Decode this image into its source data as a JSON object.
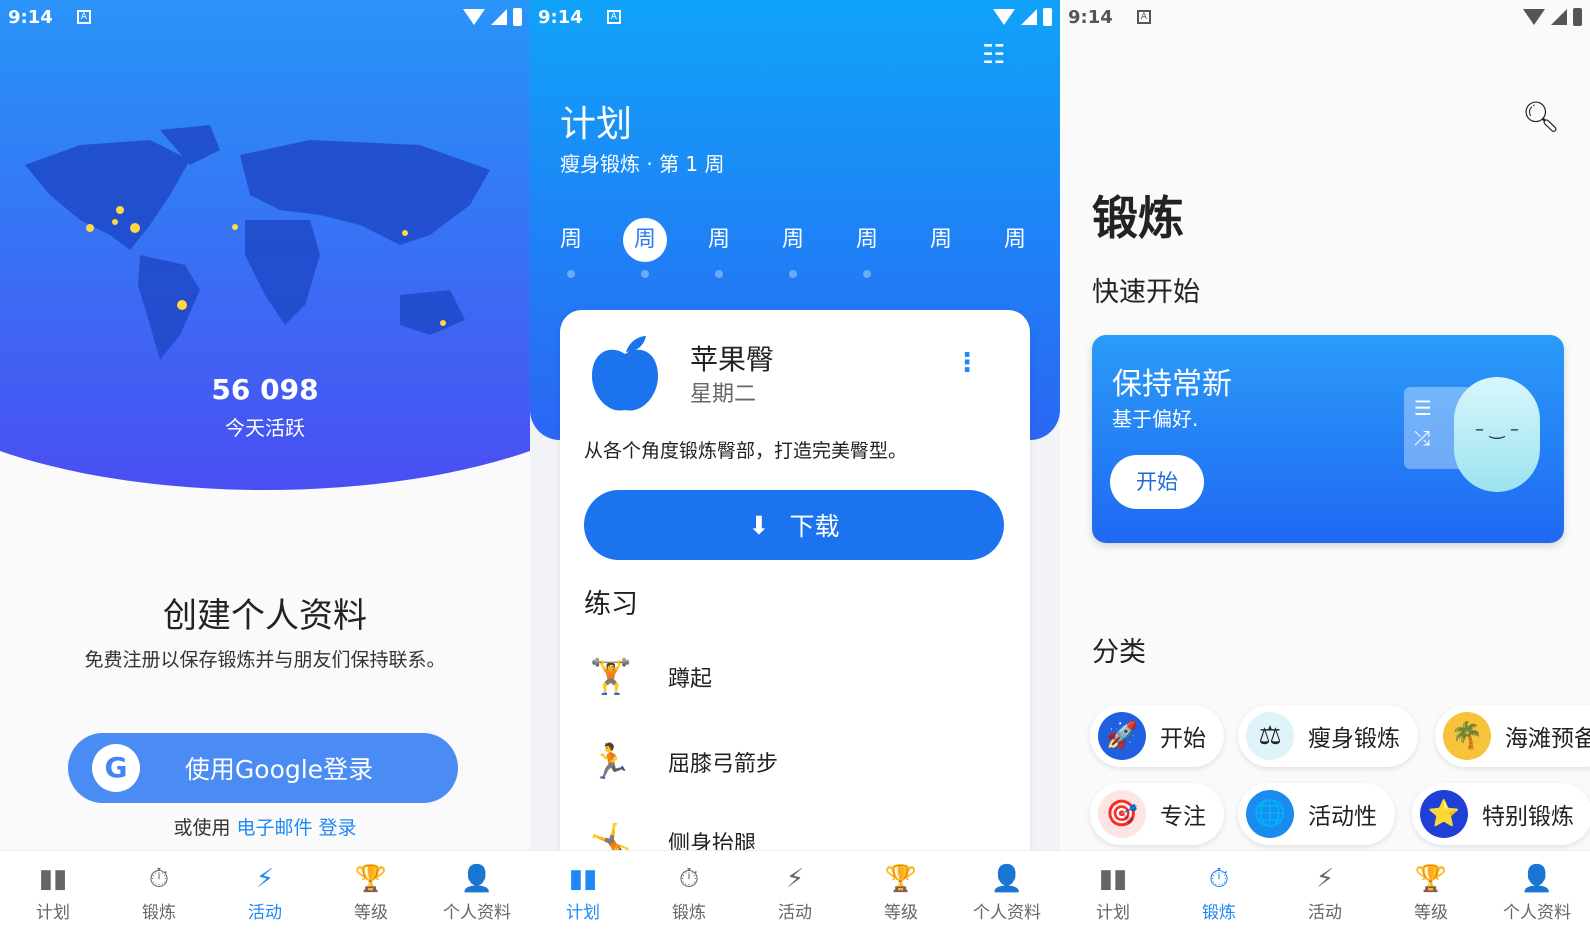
{
  "status": {
    "time": "9:14",
    "notif": "A"
  },
  "nav": [
    {
      "label": "计划",
      "icon": "cards-icon"
    },
    {
      "label": "锻炼",
      "icon": "stopwatch-icon"
    },
    {
      "label": "活动",
      "icon": "lightning-icon"
    },
    {
      "label": "等级",
      "icon": "trophy-icon"
    },
    {
      "label": "个人资料",
      "icon": "person-icon"
    }
  ],
  "accent": "#1e88f5",
  "activity": {
    "count": "56 098",
    "count_label": "今天活跃",
    "title": "创建个人资料",
    "subtitle": "免费注册以保存锻炼并与朋友们保持联系。",
    "google_button": "使用Google登录",
    "google_logo": "G",
    "alt_prefix": "或使用",
    "alt_link": "电子邮件 登录"
  },
  "plan": {
    "title": "计划",
    "subtitle": "瘦身锻炼 · 第 1 周",
    "days": [
      "周",
      "周",
      "周",
      "周",
      "周",
      "周",
      "周"
    ],
    "selected_day": 1,
    "card": {
      "title": "苹果臀",
      "day": "星期二",
      "description": "从各个角度锻炼臀部，打造完美臀型。",
      "download": "下载",
      "section": "练习",
      "exercises": [
        {
          "name": "蹲起",
          "icon": "🏋"
        },
        {
          "name": "屈膝弓箭步",
          "icon": "🏃"
        },
        {
          "name": "侧身抬腿",
          "icon": "🤸"
        }
      ]
    }
  },
  "workout": {
    "title": "锻炼",
    "quick_start": "快速开始",
    "promo": {
      "title": "保持常新",
      "subtitle": "基于偏好.",
      "button": "开始"
    },
    "categories_title": "分类",
    "categories": [
      {
        "label": "开始",
        "icon": "🚀",
        "color": "#1f5fe0"
      },
      {
        "label": "瘦身锻炼",
        "icon": "⚖",
        "color": "#dff3fb"
      },
      {
        "label": "海滩预备",
        "icon": "🌴",
        "color": "#f6c33a"
      },
      {
        "label": "专注",
        "icon": "🎯",
        "color": "#e62a2a"
      },
      {
        "label": "活动性",
        "icon": "🌐",
        "color": "#1a8cf0"
      },
      {
        "label": "特别锻炼",
        "icon": "⭐",
        "color": "#1f3fd6"
      }
    ]
  }
}
